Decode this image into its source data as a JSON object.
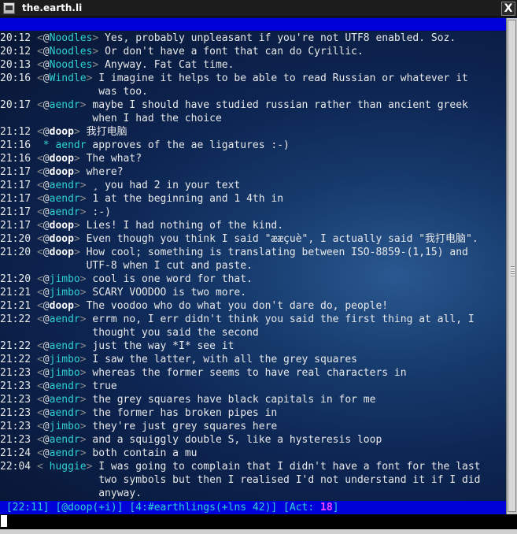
{
  "window": {
    "title": "the.earth.li",
    "close_glyph": "X"
  },
  "lines": [
    {
      "time": "20:12",
      "nick": "Noodles",
      "mode": "@",
      "msg": "Yes, probably unpleasant if you're not UTF8 enabled. Soz."
    },
    {
      "time": "20:12",
      "nick": "Noodles",
      "mode": "@",
      "msg": "Or don't have a font that can do Cyrillic."
    },
    {
      "time": "20:13",
      "nick": "Noodles",
      "mode": "@",
      "msg": "Anyway. Fat Cat time."
    },
    {
      "time": "20:16",
      "nick": "Windle",
      "mode": "@",
      "msg": "I imagine it helps to be able to read Russian or whatever it"
    },
    {
      "cont": "was too."
    },
    {
      "time": "20:17",
      "nick": "aendr",
      "mode": "@",
      "msg": "maybe I should have studied russian rather than ancient greek"
    },
    {
      "cont": "when I had the choice"
    },
    {
      "time": "21:12",
      "nick": "doop",
      "mode": "@",
      "self": true,
      "msg": "我打电脑"
    },
    {
      "time": "21:16",
      "action": true,
      "nick": "aendr",
      "msg": "approves of the ae ligatures :-)"
    },
    {
      "time": "21:16",
      "nick": "doop",
      "mode": "@",
      "self": true,
      "msg": "The what?"
    },
    {
      "time": "21:17",
      "nick": "doop",
      "mode": "@",
      "self": true,
      "msg": "where?"
    },
    {
      "time": "21:17",
      "nick": "aendr",
      "mode": "@",
      "msg": "¸ you had 2 in your text"
    },
    {
      "time": "21:17",
      "nick": "aendr",
      "mode": "@",
      "msg": "1 at the beginning and 1 4th in"
    },
    {
      "time": "21:17",
      "nick": "aendr",
      "mode": "@",
      "msg": ":-)"
    },
    {
      "time": "21:17",
      "nick": "doop",
      "mode": "@",
      "self": true,
      "msg": "Lies! I had nothing of the kind."
    },
    {
      "time": "21:20",
      "nick": "doop",
      "mode": "@",
      "self": true,
      "msg": "Even though you think I said \"ææçuè\", I actually said \"我打电脑\"."
    },
    {
      "time": "21:20",
      "nick": "doop",
      "mode": "@",
      "self": true,
      "msg": "How cool; something is translating between ISO-8859-(1,15) and"
    },
    {
      "cont": "UTF-8 when I cut and paste."
    },
    {
      "time": "21:20",
      "nick": "jimbo",
      "mode": "@",
      "msg": "cool is one word for that."
    },
    {
      "time": "21:21",
      "nick": "jimbo",
      "mode": "@",
      "msg": "SCARY VOODOO is two more."
    },
    {
      "time": "21:21",
      "nick": "doop",
      "mode": "@",
      "self": true,
      "msg": "The voodoo who do what you don't dare do, people!"
    },
    {
      "time": "21:22",
      "nick": "aendr",
      "mode": "@",
      "msg": "errm no, I err didn't think you said the first thing at all, I"
    },
    {
      "cont": "thought you said the second"
    },
    {
      "time": "21:22",
      "nick": "aendr",
      "mode": "@",
      "msg": "just the way *I* see it"
    },
    {
      "time": "21:22",
      "nick": "jimbo",
      "mode": "@",
      "msg": "I saw the latter, with all the grey squares"
    },
    {
      "time": "21:23",
      "nick": "jimbo",
      "mode": "@",
      "msg": "whereas the former seems to have real characters in"
    },
    {
      "time": "21:23",
      "nick": "aendr",
      "mode": "@",
      "msg": "true"
    },
    {
      "time": "21:23",
      "nick": "aendr",
      "mode": "@",
      "msg": "the grey squares have black capitals in for me"
    },
    {
      "time": "21:23",
      "nick": "aendr",
      "mode": "@",
      "msg": "the former has broken pipes in"
    },
    {
      "time": "21:23",
      "nick": "jimbo",
      "mode": "@",
      "msg": "they're just grey squares here"
    },
    {
      "time": "21:23",
      "nick": "aendr",
      "mode": "@",
      "msg": "and a squiggly double S, like a hysteresis loop"
    },
    {
      "time": "21:24",
      "nick": "aendr",
      "mode": "@",
      "msg": "both contain a mu"
    },
    {
      "time": "22:04",
      "nick": "huggie",
      "mode": " ",
      "msg": "I was going to complain that I didn't have a font for the last"
    },
    {
      "cont": "two symbols but then I realised I'd not understand it if I did"
    },
    {
      "cont": "anyway."
    }
  ],
  "status": {
    "time": "22:11",
    "user": "@doop(+i)",
    "channel": "4:#earthlings(+lns 42)",
    "act_label": "Act:",
    "act_value": "18"
  },
  "colors": {
    "nick": "#2ed1d1",
    "self_nick": "#ffffff",
    "bar_bg": "#0000d8",
    "activity": "#ff44ff"
  }
}
